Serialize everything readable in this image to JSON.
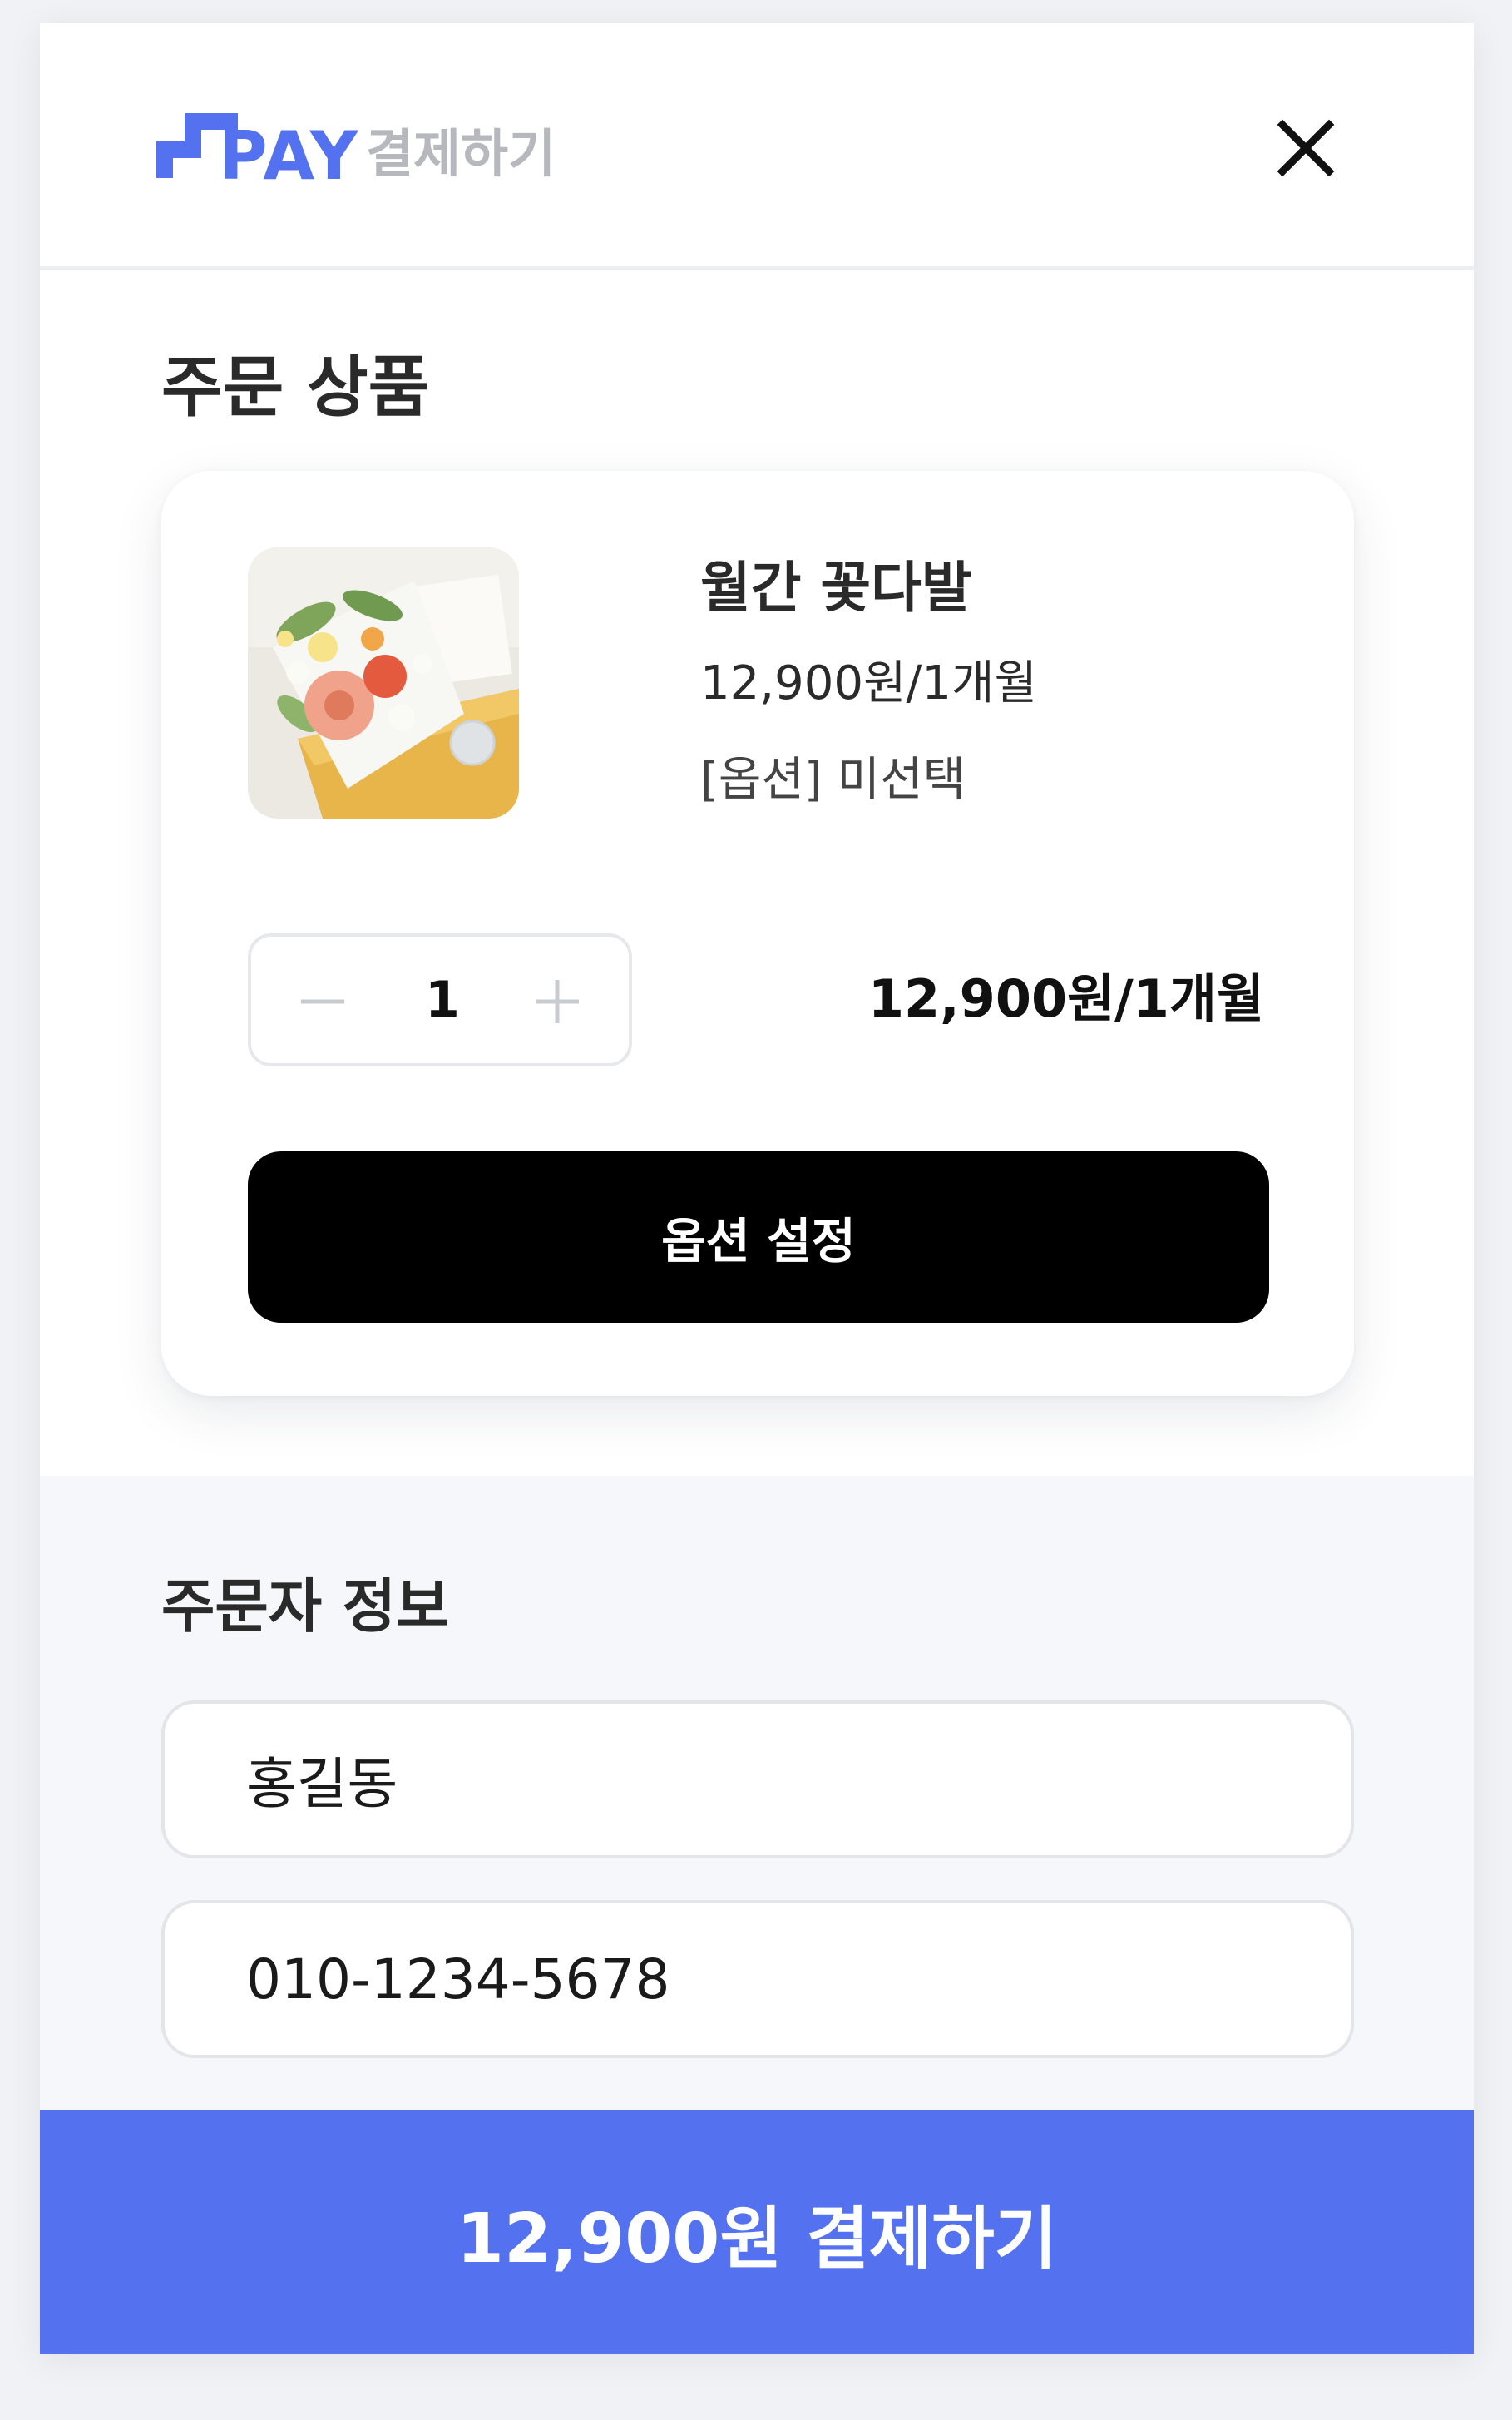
{
  "header": {
    "logo_text": "PAY",
    "title": "결제하기",
    "close_icon": "close-icon",
    "brand_color": "#5472f0"
  },
  "order": {
    "section_title": "주문 상품",
    "product": {
      "image_icon": "flower-bouquet-image",
      "name": "월간 꽃다발",
      "price": "12,900원/1개월",
      "option": "[옵션] 미선택",
      "quantity": "1",
      "total": "12,900원/1개월"
    },
    "option_button_label": "옵션 설정"
  },
  "orderer": {
    "section_title": "주문자 정보",
    "name_value": "홍길동",
    "phone_value": "010-1234-5678"
  },
  "footer": {
    "pay_button_label": "12,900원 결제하기"
  }
}
